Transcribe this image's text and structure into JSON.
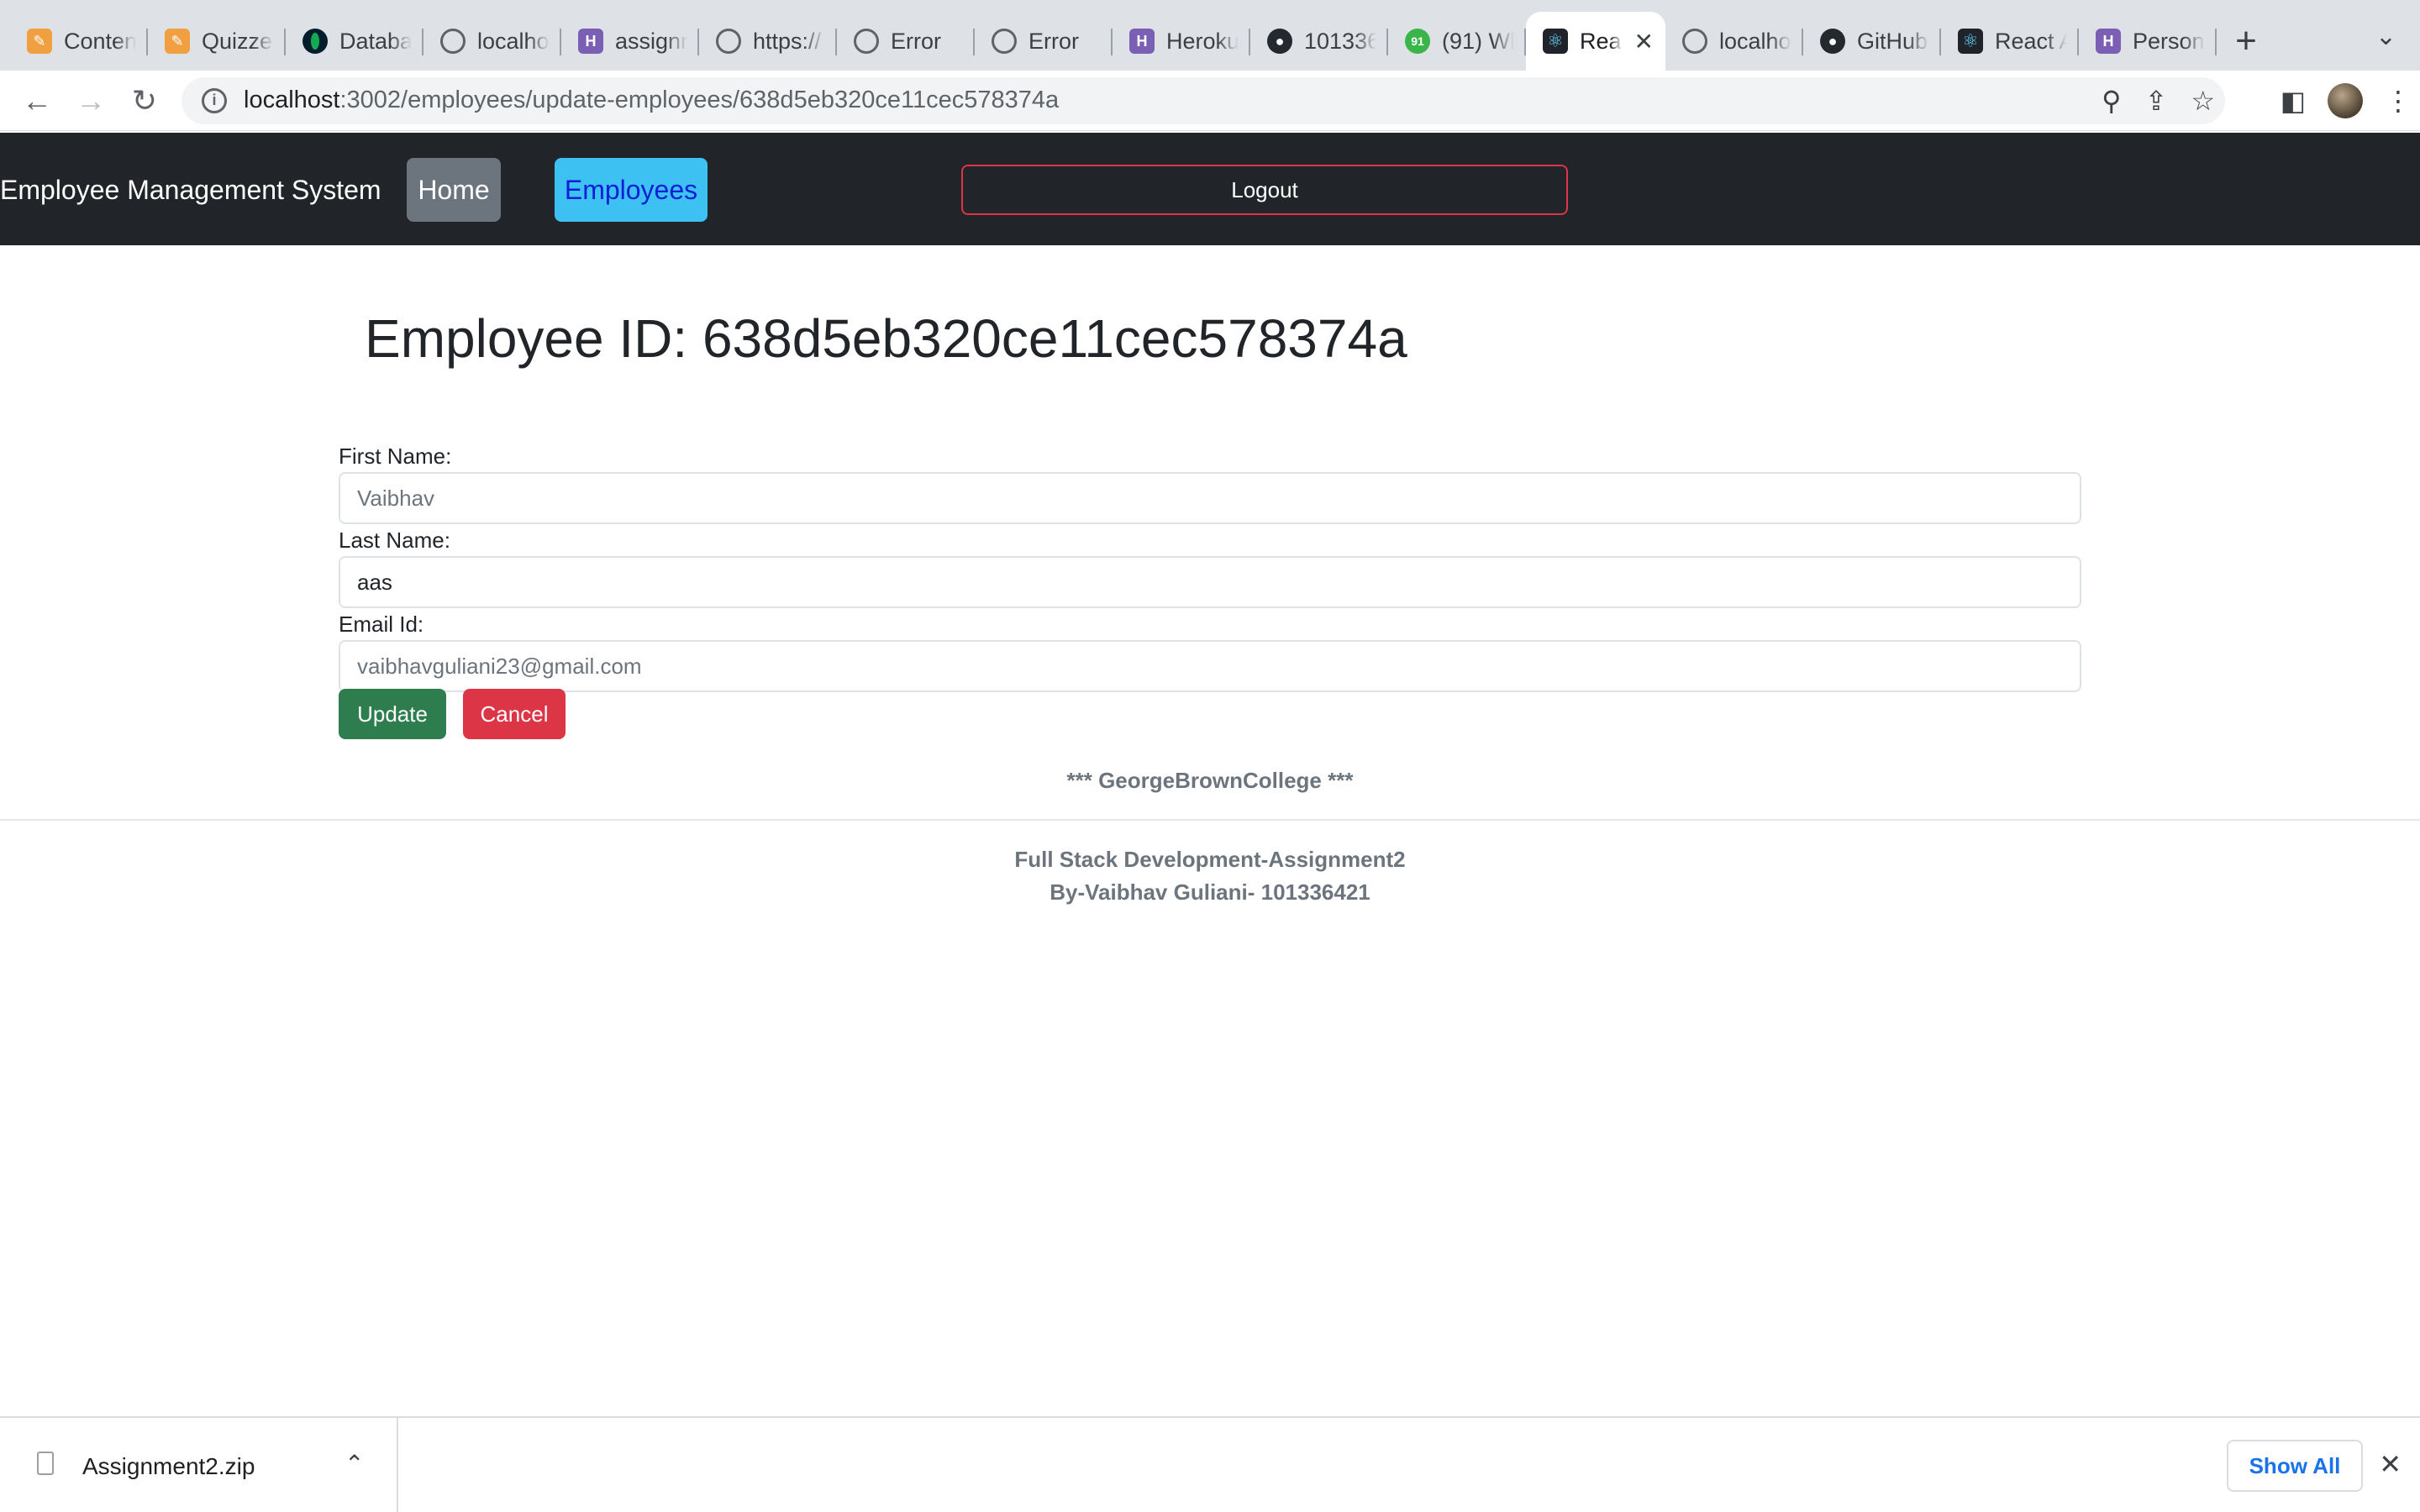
{
  "browser": {
    "tabs": [
      {
        "label": "Conten",
        "icon": "pencil-icon"
      },
      {
        "label": "Quizze",
        "icon": "pencil-icon"
      },
      {
        "label": "Databa",
        "icon": "mongodb-icon"
      },
      {
        "label": "localho",
        "icon": "globe-icon"
      },
      {
        "label": "assignn",
        "icon": "heroku-icon"
      },
      {
        "label": "https://",
        "icon": "globe-icon"
      },
      {
        "label": "Error",
        "icon": "globe-icon"
      },
      {
        "label": "Error",
        "icon": "globe-icon"
      },
      {
        "label": "Heroku",
        "icon": "heroku-icon"
      },
      {
        "label": "101336",
        "icon": "github-icon"
      },
      {
        "label": "(91) Wh",
        "icon": "whatsapp-icon"
      },
      {
        "label": "Rea",
        "icon": "react-icon",
        "active": true
      },
      {
        "label": "localho",
        "icon": "globe-icon"
      },
      {
        "label": "GitHub",
        "icon": "github-icon"
      },
      {
        "label": "React A",
        "icon": "react-icon"
      },
      {
        "label": "Person",
        "icon": "heroku-icon"
      }
    ],
    "url_host": "localhost",
    "url_path": ":3002/employees/update-employees/638d5eb320ce11cec578374a"
  },
  "navbar": {
    "brand": "Employee Management System",
    "home_label": "Home",
    "employees_label": "Employees",
    "logout_label": "Logout"
  },
  "page": {
    "title": "Employee ID: 638d5eb320ce11cec578374a"
  },
  "form": {
    "first_name_label": "First Name:",
    "first_name_placeholder": "Vaibhav",
    "last_name_label": "Last Name:",
    "last_name_value": "aas",
    "email_label": "Email Id:",
    "email_placeholder": "vaibhavguliani23@gmail.com",
    "update_label": "Update",
    "cancel_label": "Cancel"
  },
  "footer": {
    "college": "*** GeorgeBrownCollege ***",
    "line1": "Full Stack Development-Assignment2",
    "line2": "By-Vaibhav Guliani- 101336421"
  },
  "downloads": {
    "file_name": "Assignment2.zip",
    "show_all_label": "Show All"
  },
  "colors": {
    "navbar_bg": "#212529",
    "home_btn": "#6c757d",
    "employees_btn": "#3dc1f3",
    "logout_border": "#dc3545",
    "update_btn": "#2e7d4f",
    "cancel_btn": "#dc3545"
  }
}
